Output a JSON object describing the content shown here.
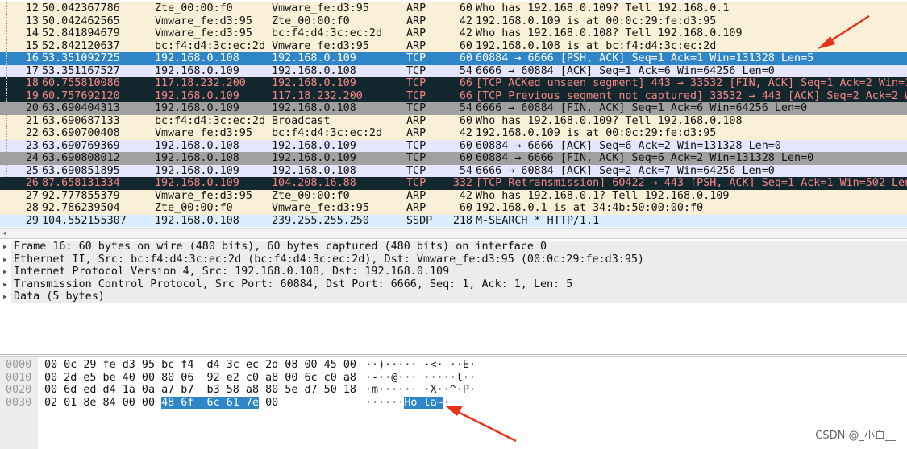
{
  "colors": {
    "arp": "#faf0d7",
    "tcp": "#e7e6ff",
    "selected": "#2e86c8",
    "bad": "#12272e",
    "bad_text": "#f78787",
    "gray": "#a0a0a0",
    "ssdp": "#daeeff",
    "annotation_arrow": "#e8321e"
  },
  "packets": [
    {
      "no": "12",
      "time": "50.042367786",
      "src": "Zte_00:00:f0",
      "dst": "Vmware_fe:d3:95",
      "proto": "ARP",
      "len": "60",
      "info": "Who has 192.168.0.109? Tell 192.168.0.1",
      "style": "arp"
    },
    {
      "no": "13",
      "time": "50.042462565",
      "src": "Vmware_fe:d3:95",
      "dst": "Zte_00:00:f0",
      "proto": "ARP",
      "len": "42",
      "info": "192.168.0.109 is at 00:0c:29:fe:d3:95",
      "style": "arp"
    },
    {
      "no": "14",
      "time": "52.841894679",
      "src": "Vmware_fe:d3:95",
      "dst": "bc:f4:d4:3c:ec:2d",
      "proto": "ARP",
      "len": "42",
      "info": "Who has 192.168.0.108? Tell 192.168.0.109",
      "style": "arp"
    },
    {
      "no": "15",
      "time": "52.842120637",
      "src": "bc:f4:d4:3c:ec:2d",
      "dst": "Vmware_fe:d3:95",
      "proto": "ARP",
      "len": "60",
      "info": "192.168.0.108 is at bc:f4:d4:3c:ec:2d",
      "style": "arp"
    },
    {
      "no": "16",
      "time": "53.351092725",
      "src": "192.168.0.108",
      "dst": "192.168.0.109",
      "proto": "TCP",
      "len": "60",
      "info": "60884 → 6666 [PSH, ACK] Seq=1 Ack=1 Win=131328 Len=5",
      "style": "selected"
    },
    {
      "no": "17",
      "time": "53.351167527",
      "src": "192.168.0.109",
      "dst": "192.168.0.108",
      "proto": "TCP",
      "len": "54",
      "info": "6666 → 60884 [ACK] Seq=1 Ack=6 Win=64256 Len=0",
      "style": "tcp"
    },
    {
      "no": "18",
      "time": "60.755810086",
      "src": "117.18.232.200",
      "dst": "192.168.0.109",
      "proto": "TCP",
      "len": "66",
      "info": "[TCP ACKed unseen segment] 443 → 33532 [FIN, ACK] Seq=1 Ack=2 Win=1",
      "style": "bad"
    },
    {
      "no": "19",
      "time": "60.757692120",
      "src": "192.168.0.109",
      "dst": "117.18.232.200",
      "proto": "TCP",
      "len": "66",
      "info": "[TCP Previous segment not captured] 33532 → 443 [ACK] Seq=2 Ack=2 W",
      "style": "bad"
    },
    {
      "no": "20",
      "time": "63.690404313",
      "src": "192.168.0.109",
      "dst": "192.168.0.108",
      "proto": "TCP",
      "len": "54",
      "info": "6666 → 60884 [FIN, ACK] Seq=1 Ack=6 Win=64256 Len=0",
      "style": "gray"
    },
    {
      "no": "21",
      "time": "63.690687133",
      "src": "bc:f4:d4:3c:ec:2d",
      "dst": "Broadcast",
      "proto": "ARP",
      "len": "60",
      "info": "Who has 192.168.0.109? Tell 192.168.0.108",
      "style": "arp"
    },
    {
      "no": "22",
      "time": "63.690700408",
      "src": "Vmware_fe:d3:95",
      "dst": "bc:f4:d4:3c:ec:2d",
      "proto": "ARP",
      "len": "42",
      "info": "192.168.0.109 is at 00:0c:29:fe:d3:95",
      "style": "arp"
    },
    {
      "no": "23",
      "time": "63.690769369",
      "src": "192.168.0.108",
      "dst": "192.168.0.109",
      "proto": "TCP",
      "len": "60",
      "info": "60884 → 6666 [ACK] Seq=6 Ack=2 Win=131328 Len=0",
      "style": "tcp"
    },
    {
      "no": "24",
      "time": "63.690808012",
      "src": "192.168.0.108",
      "dst": "192.168.0.109",
      "proto": "TCP",
      "len": "60",
      "info": "60884 → 6666 [FIN, ACK] Seq=6 Ack=2 Win=131328 Len=0",
      "style": "gray"
    },
    {
      "no": "25",
      "time": "63.690851895",
      "src": "192.168.0.109",
      "dst": "192.168.0.108",
      "proto": "TCP",
      "len": "54",
      "info": "6666 → 60884 [ACK] Seq=2 Ack=7 Win=64256 Len=0",
      "style": "tcp"
    },
    {
      "no": "26",
      "time": "87.658131334",
      "src": "192.168.0.109",
      "dst": "104.208.16.88",
      "proto": "TCP",
      "len": "332",
      "info": "[TCP Retransmission] 60422 → 443 [PSH, ACK] Seq=1 Ack=1 Win=502 Len",
      "style": "bad"
    },
    {
      "no": "27",
      "time": "92.777855379",
      "src": "Vmware_fe:d3:95",
      "dst": "Zte_00:00:f0",
      "proto": "ARP",
      "len": "42",
      "info": "Who has 192.168.0.1? Tell 192.168.0.109",
      "style": "arp"
    },
    {
      "no": "28",
      "time": "92.786239504",
      "src": "Zte_00:00:f0",
      "dst": "Vmware_fe:d3:95",
      "proto": "ARP",
      "len": "60",
      "info": "192.168.0.1 is at 34:4b:50:00:00:f0",
      "style": "arp"
    },
    {
      "no": "29",
      "time": "104.552155307",
      "src": "192.168.0.108",
      "dst": "239.255.255.250",
      "proto": "SSDP",
      "len": "218",
      "info": "M-SEARCH * HTTP/1.1",
      "style": "ssdp"
    }
  ],
  "details": [
    "Frame 16: 60 bytes on wire (480 bits), 60 bytes captured (480 bits) on interface 0",
    "Ethernet II, Src: bc:f4:d4:3c:ec:2d (bc:f4:d4:3c:ec:2d), Dst: Vmware_fe:d3:95 (00:0c:29:fe:d3:95)",
    "Internet Protocol Version 4, Src: 192.168.0.108, Dst: 192.168.0.109",
    "Transmission Control Protocol, Src Port: 60884, Dst Port: 6666, Seq: 1, Ack: 1, Len: 5",
    "Data (5 bytes)"
  ],
  "hex": [
    {
      "offset": "0000",
      "bytes": "00 0c 29 fe d3 95 bc f4  d4 3c ec 2d 08 00 45 00",
      "ascii": "··)····· ·<·-··E·"
    },
    {
      "offset": "0010",
      "bytes": "00 2d e5 be 40 00 80 06  92 e2 c0 a8 00 6c c0 a8",
      "ascii": "·-··@··· ·····l··"
    },
    {
      "offset": "0020",
      "bytes": "00 6d ed d4 1a 0a a7 b7  b3 58 a8 80 5e d7 50 18",
      "ascii": "·m······ ·X··^·P·"
    },
    {
      "offset": "0030",
      "bytes_pre": "02 01 8e 84 00 00 ",
      "bytes_sel": "48 6f  6c 61 7e",
      "bytes_post": " 00",
      "ascii_pre": "······",
      "ascii_sel": "Ho la~",
      "ascii_post": "·"
    }
  ],
  "watermark": "CSDN @_小白__"
}
